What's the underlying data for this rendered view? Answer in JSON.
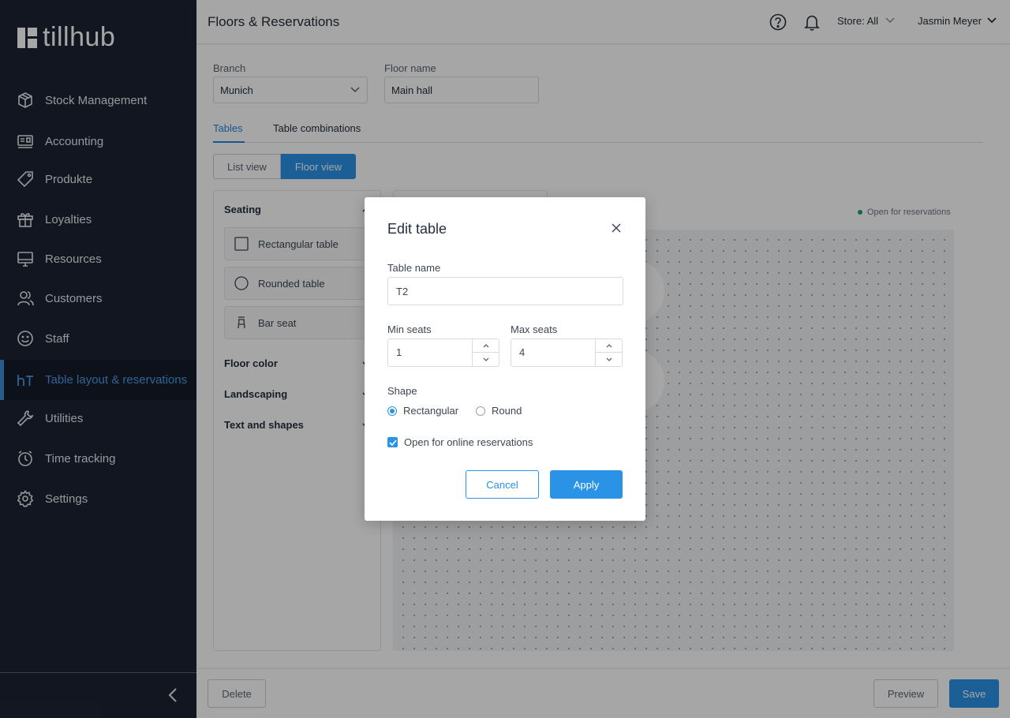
{
  "app": {
    "logo_text": "tillhub",
    "page_title": "Floors & Reservations",
    "store_selector": "Store: All",
    "user_name": "Jasmin Meyer"
  },
  "sidebar": {
    "items": [
      {
        "label": "Stock Management",
        "icon": "box-icon"
      },
      {
        "label": "Accounting",
        "icon": "cash-register-icon"
      },
      {
        "label": "Produkte",
        "icon": "tag-icon"
      },
      {
        "label": "Loyalties",
        "icon": "gift-icon"
      },
      {
        "label": "Resources",
        "icon": "monitor-icon"
      },
      {
        "label": "Customers",
        "icon": "users-icon"
      },
      {
        "label": "Staff",
        "icon": "smiley-icon"
      },
      {
        "label": "Table layout & reservations",
        "icon": "ht-icon",
        "active": true
      },
      {
        "label": "Utilities",
        "icon": "wrench-icon"
      },
      {
        "label": "Time tracking",
        "icon": "clock-icon"
      },
      {
        "label": "Settings",
        "icon": "gear-icon"
      }
    ]
  },
  "form": {
    "branch_label": "Branch",
    "branch_value": "Munich",
    "floor_name_label": "Floor name",
    "floor_name_value": "Main hall"
  },
  "tabs": [
    "Tables",
    "Table combinations"
  ],
  "view_toggle": {
    "list": "List view",
    "floor": "Floor view",
    "selected": "Floor view"
  },
  "panel": {
    "seating_title": "Seating",
    "items": [
      "Rectangular table",
      "Rounded table",
      "Bar seat"
    ],
    "floor_color": "Floor color",
    "landscaping": "Landscaping",
    "text_and_shapes": "Text and shapes"
  },
  "legend": {
    "label": "Open for reservations",
    "color": "#1b9c85"
  },
  "footer": {
    "delete": "Delete",
    "preview": "Preview",
    "save": "Save"
  },
  "modal": {
    "title": "Edit table",
    "table_name_label": "Table name",
    "table_name_value": "T2",
    "min_seats_label": "Min seats",
    "min_seats_value": "1",
    "max_seats_label": "Max seats",
    "max_seats_value": "4",
    "shape_label": "Shape",
    "shape_options": [
      "Rectangular",
      "Round"
    ],
    "shape_selected": "Rectangular",
    "online_reservations_label": "Open for online reservations",
    "online_reservations_checked": true,
    "cancel": "Cancel",
    "apply": "Apply"
  },
  "colors": {
    "accent": "#2a93e6",
    "sidebar_bg": "#1b2332",
    "active_nav": "#4a9be6"
  }
}
